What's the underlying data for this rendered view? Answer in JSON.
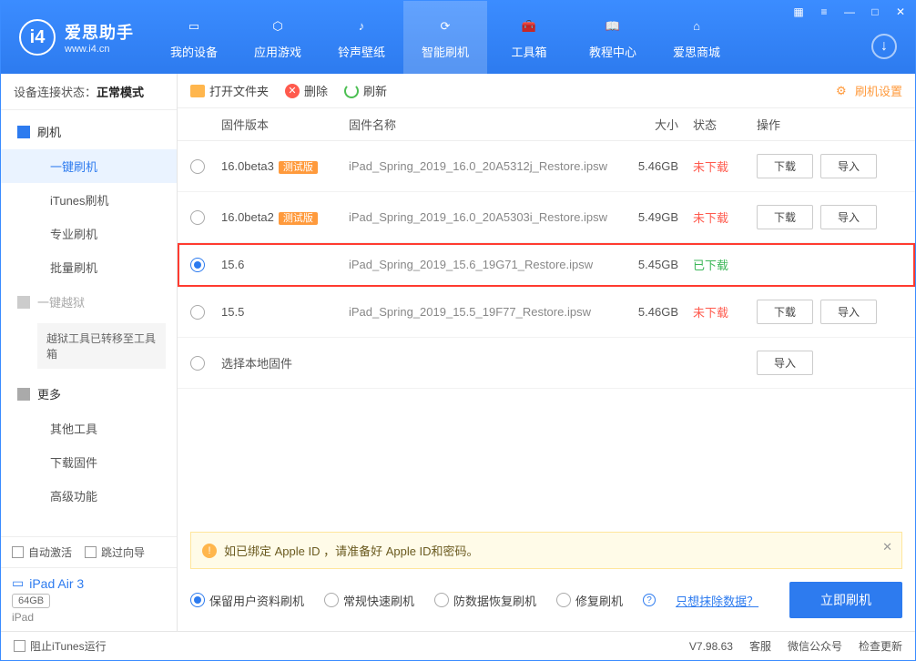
{
  "app": {
    "title": "爱思助手",
    "url": "www.i4.cn"
  },
  "nav": {
    "items": [
      {
        "label": "我的设备"
      },
      {
        "label": "应用游戏"
      },
      {
        "label": "铃声壁纸"
      },
      {
        "label": "智能刷机"
      },
      {
        "label": "工具箱"
      },
      {
        "label": "教程中心"
      },
      {
        "label": "爱思商城"
      }
    ]
  },
  "sidebar": {
    "status_label": "设备连接状态：",
    "status_value": "正常模式",
    "groups": {
      "flash": "刷机",
      "flash_items": [
        "一键刷机",
        "iTunes刷机",
        "专业刷机",
        "批量刷机"
      ],
      "jailbreak": "一键越狱",
      "jailbreak_note": "越狱工具已转移至工具箱",
      "more": "更多",
      "more_items": [
        "其他工具",
        "下载固件",
        "高级功能"
      ]
    },
    "auto_activate": "自动激活",
    "skip_guide": "跳过向导",
    "device": {
      "name": "iPad Air 3",
      "capacity": "64GB",
      "type": "iPad"
    }
  },
  "toolbar": {
    "open_folder": "打开文件夹",
    "delete": "删除",
    "refresh": "刷新",
    "settings": "刷机设置"
  },
  "table": {
    "headers": {
      "version": "固件版本",
      "name": "固件名称",
      "size": "大小",
      "status": "状态",
      "ops": "操作"
    },
    "btn_download": "下载",
    "btn_import": "导入",
    "rows": [
      {
        "version": "16.0beta3",
        "beta": "测试版",
        "name": "iPad_Spring_2019_16.0_20A5312j_Restore.ipsw",
        "size": "5.46GB",
        "status": "未下载",
        "downloaded": false,
        "selected": false,
        "ops": true
      },
      {
        "version": "16.0beta2",
        "beta": "测试版",
        "name": "iPad_Spring_2019_16.0_20A5303i_Restore.ipsw",
        "size": "5.49GB",
        "status": "未下载",
        "downloaded": false,
        "selected": false,
        "ops": true
      },
      {
        "version": "15.6",
        "beta": "",
        "name": "iPad_Spring_2019_15.6_19G71_Restore.ipsw",
        "size": "5.45GB",
        "status": "已下载",
        "downloaded": true,
        "selected": true,
        "ops": false
      },
      {
        "version": "15.5",
        "beta": "",
        "name": "iPad_Spring_2019_15.5_19F77_Restore.ipsw",
        "size": "5.46GB",
        "status": "未下载",
        "downloaded": false,
        "selected": false,
        "ops": true
      }
    ],
    "local_row": "选择本地固件"
  },
  "warning": "如已绑定 Apple ID ，请准备好 Apple ID和密码。",
  "options": {
    "keep_data": "保留用户资料刷机",
    "normal": "常规快速刷机",
    "anti_recovery": "防数据恢复刷机",
    "repair": "修复刷机",
    "erase_link": "只想抹除数据？",
    "flash_now": "立即刷机"
  },
  "footer": {
    "block_itunes": "阻止iTunes运行",
    "version": "V7.98.63",
    "service": "客服",
    "wechat": "微信公众号",
    "check_update": "检查更新"
  }
}
